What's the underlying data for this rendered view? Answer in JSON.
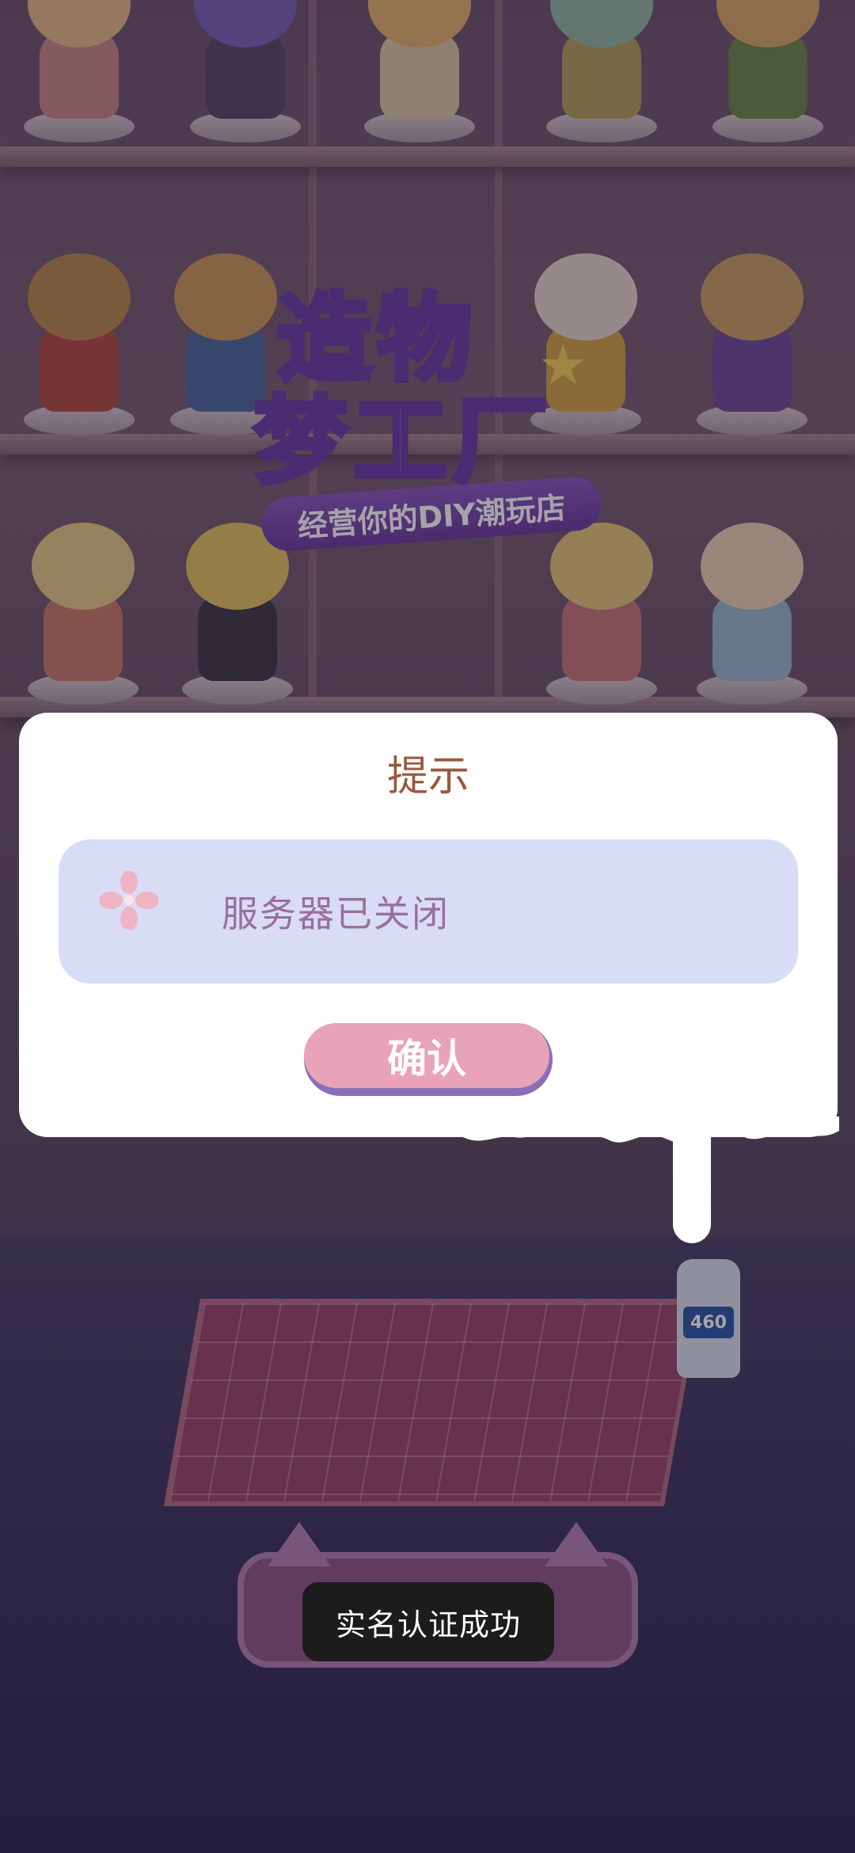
{
  "background": {
    "logo_line1": "造物",
    "logo_line2": "梦工厂",
    "logo_ribbon": "经营你的DIY潮玩店",
    "bottle_label": "460"
  },
  "dialog": {
    "title": "提示",
    "message": "服务器已关闭",
    "confirm_label": "确认",
    "icon": "flower-icon",
    "colors": {
      "title": "#9a5a3c",
      "message_bg": "#d9dcf5",
      "message_text": "#9a6f9c",
      "button": "#e8a3b9",
      "button_shadow": "#8a6fb8"
    }
  },
  "toast": {
    "text": "实名认证成功"
  }
}
